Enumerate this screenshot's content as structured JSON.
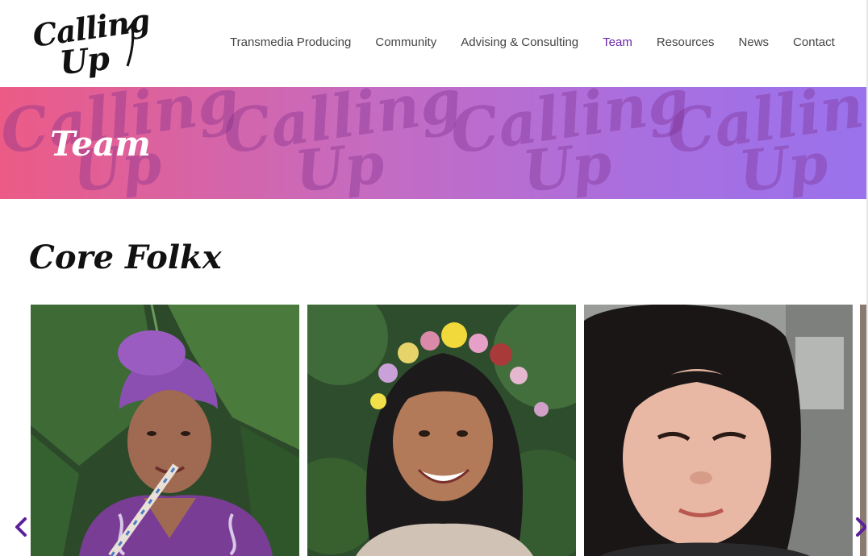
{
  "header": {
    "logo_line1": "Calling",
    "logo_line2": "Up",
    "nav": [
      {
        "label": "Transmedia Producing",
        "active": false
      },
      {
        "label": "Community",
        "active": false
      },
      {
        "label": "Advising & Consulting",
        "active": false
      },
      {
        "label": "Team",
        "active": true
      },
      {
        "label": "Resources",
        "active": false
      },
      {
        "label": "News",
        "active": false
      },
      {
        "label": "Contact",
        "active": false
      }
    ]
  },
  "banner": {
    "title": "Team",
    "watermark_line1": "Calling",
    "watermark_line2": "Up",
    "gradient": [
      "#ec5b86",
      "#c36cc4",
      "#9a72ec"
    ]
  },
  "section": {
    "title": "Core Folkx"
  },
  "carousel": {
    "prev_icon": "chevron-left-icon",
    "next_icon": "chevron-right-icon",
    "arrow_color": "#5b1f9a",
    "cards": [
      {
        "photo": "portrait-purple-headwrap"
      },
      {
        "photo": "portrait-flower-crown"
      },
      {
        "photo": "portrait-dark-hair"
      }
    ]
  },
  "colors": {
    "accent": "#6a25a8"
  }
}
